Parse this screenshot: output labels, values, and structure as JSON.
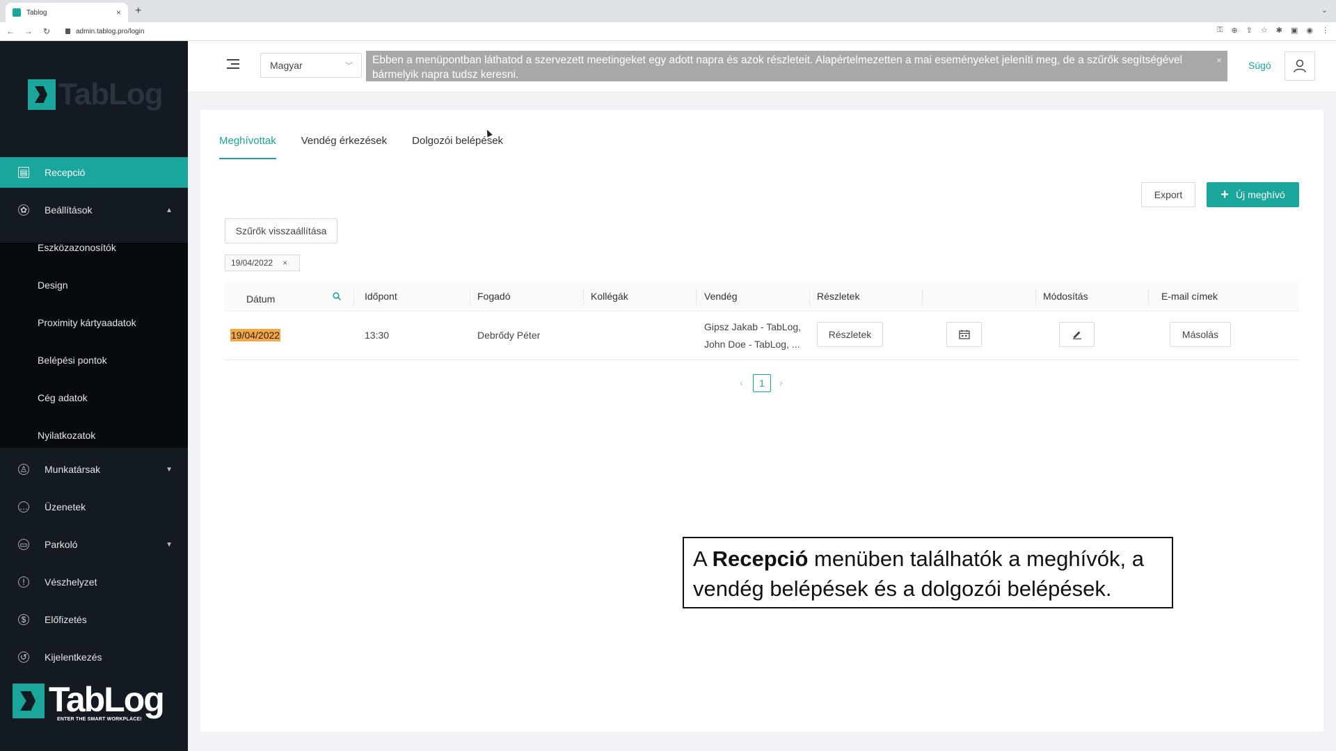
{
  "browser": {
    "tab_title": "Tablog",
    "tab_close": "×",
    "new_tab": "+",
    "url": "admin.tablog.pro/login"
  },
  "sidebar": {
    "logo_top_text": "TabLog",
    "items": [
      {
        "label": "Recepció",
        "icon": "reception-icon"
      },
      {
        "label": "Beállítások",
        "icon": "gear-icon"
      },
      {
        "label": "Munkatársak",
        "icon": "user-icon"
      },
      {
        "label": "Üzenetek",
        "icon": "message-icon"
      },
      {
        "label": "Parkoló",
        "icon": "car-icon"
      },
      {
        "label": "Vészhelyzet",
        "icon": "alert-icon"
      },
      {
        "label": "Előfizetés",
        "icon": "dollar-icon"
      },
      {
        "label": "Kijelentkezés",
        "icon": "logout-icon"
      }
    ],
    "subitems": [
      "Eszközazonosítók",
      "Design",
      "Proximity kártyaadatok",
      "Belépési pontok",
      "Cég adatok",
      "Nyilatkozatok"
    ],
    "logo_bottom": {
      "word": "TabLog",
      "tagline": "ENTER THE SMART WORKPLACE!"
    }
  },
  "header": {
    "language": "Magyar",
    "hint": "Ebben a menüpontban láthatod a szervezett meetingeket egy adott napra és azok részleteit. Alapértelmezetten a mai eseményeket jeleníti meg, de a szűrők segítségével bármelyik napra tudsz keresni.",
    "hint_close": "×",
    "help": "Súgó"
  },
  "main": {
    "tabs": [
      "Meghívottak",
      "Vendég érkezések",
      "Dolgozói belépések"
    ],
    "export": "Export",
    "new_invite": "Új meghívó",
    "reset_filters": "Szűrők visszaállítása",
    "filter_tag": "19/04/2022",
    "filter_tag_close": "×",
    "columns": [
      "Dátum",
      "Időpont",
      "Fogadó",
      "Kollégák",
      "Vendég",
      "Részletek",
      "",
      "Módosítás",
      "E-mail címek"
    ],
    "rows": [
      {
        "date": "19/04/2022",
        "time": "13:30",
        "host": "Debrődy Péter",
        "colleagues": "",
        "guest_line1": "Gipsz Jakab - TabLog,",
        "guest_line2": "John Doe - TabLog, ...",
        "details_btn": "Részletek",
        "copy_btn": "Másolás"
      }
    ],
    "page": "1"
  },
  "caption": {
    "pre": "A ",
    "bold": "Recepció",
    "post": " menüben találhatók a meghívók, a vendég belépések és a dolgozói belépések."
  },
  "colors": {
    "accent": "#1aa69a",
    "sidebar": "#141a22",
    "highlight": "#f4a742"
  }
}
